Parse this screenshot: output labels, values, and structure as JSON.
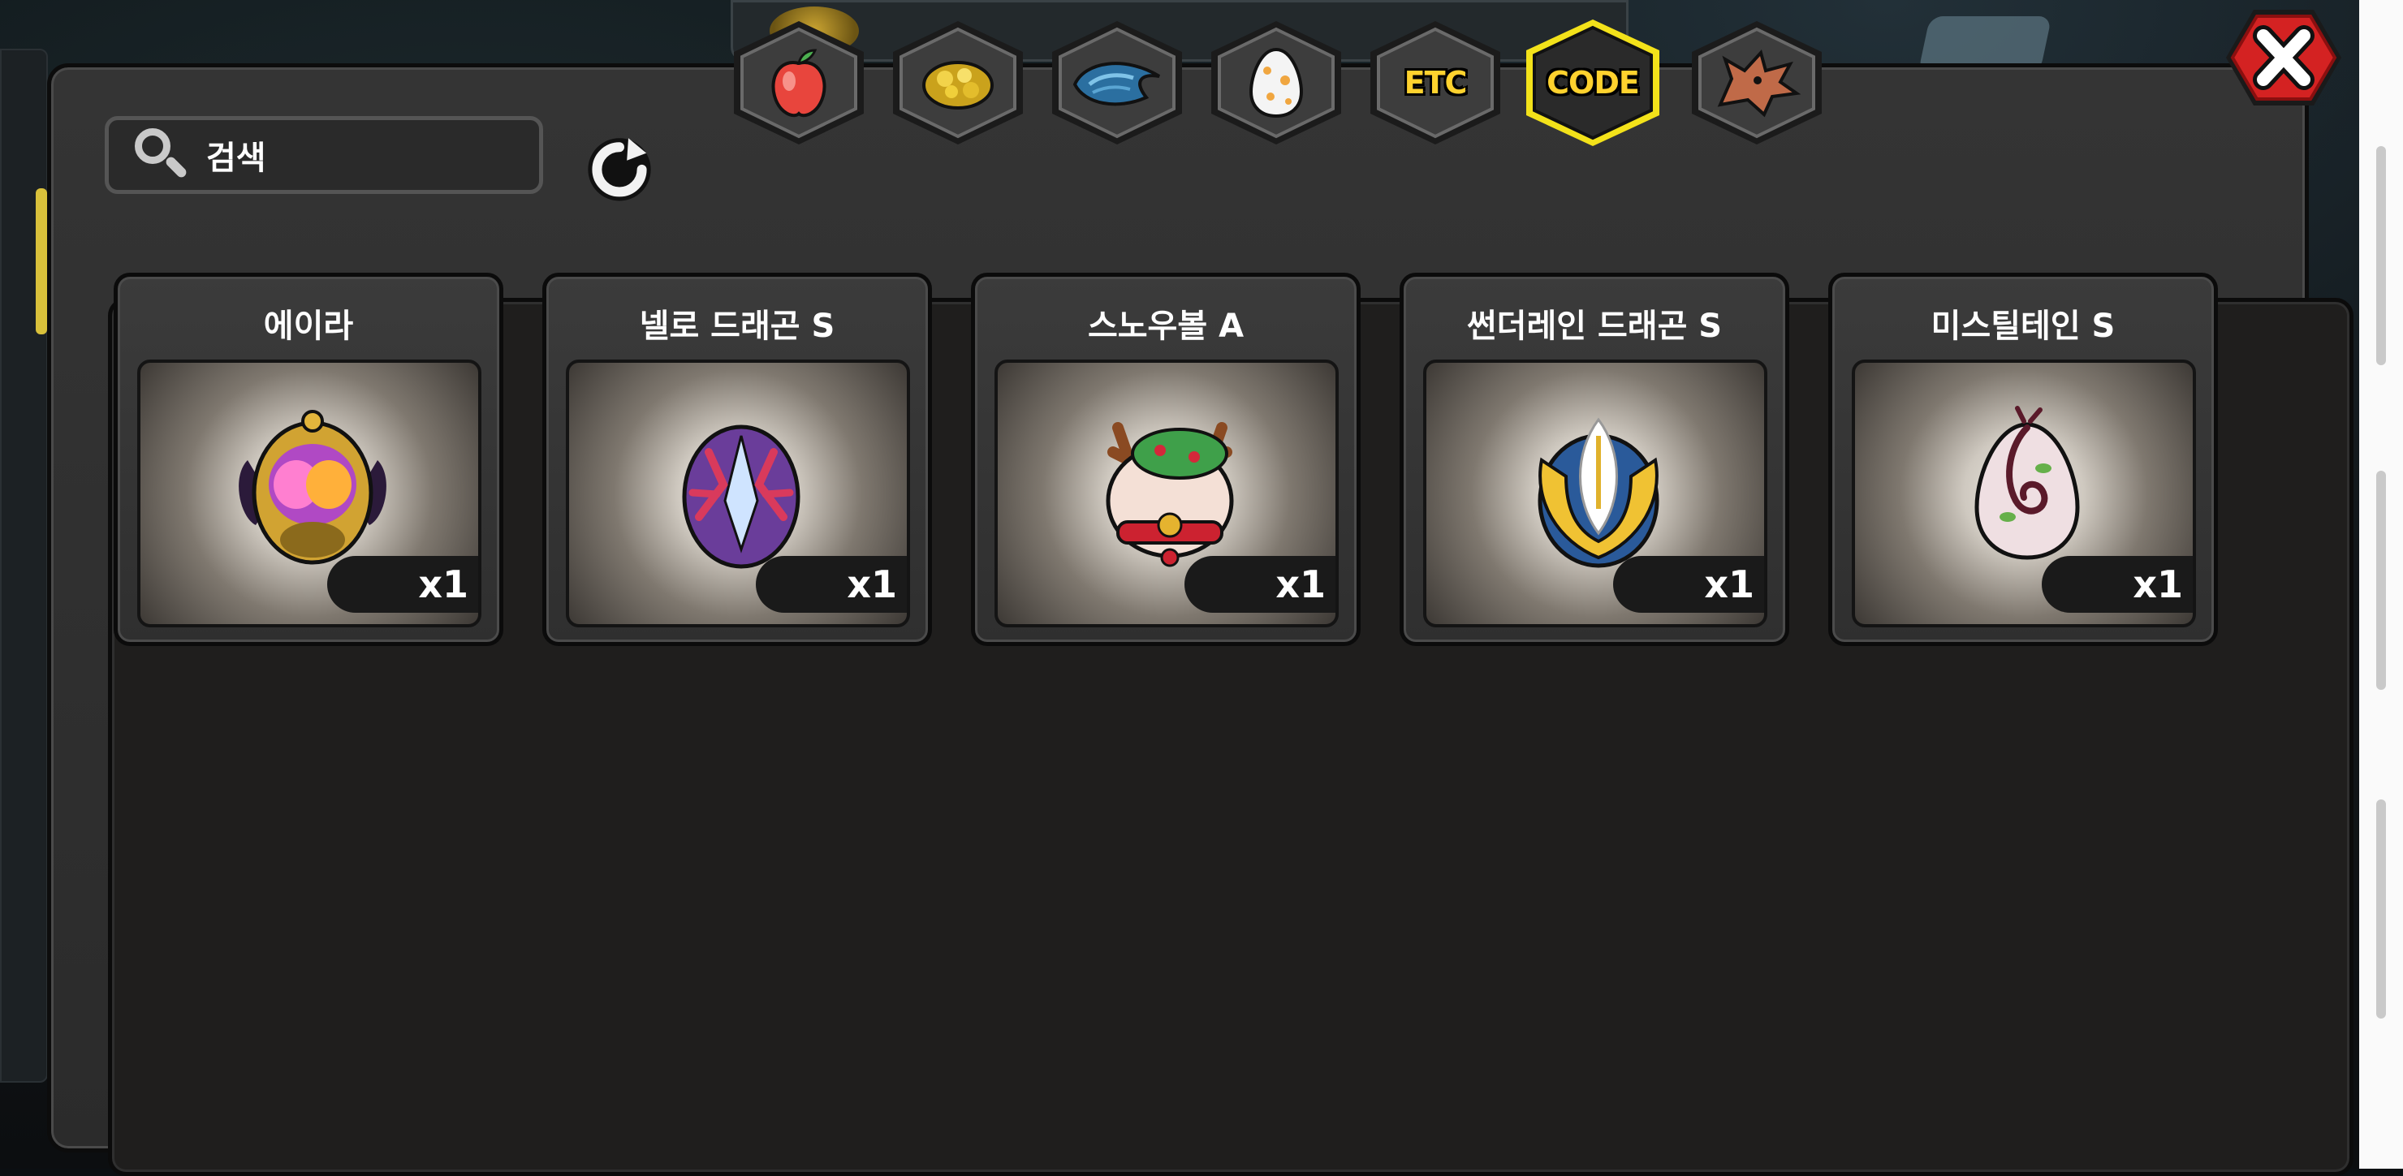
{
  "search": {
    "placeholder": "검색"
  },
  "tabs": [
    {
      "id": "fruit",
      "label": "",
      "icon": "fruit-icon",
      "selected": false
    },
    {
      "id": "gold",
      "label": "",
      "icon": "gold-icon",
      "selected": false
    },
    {
      "id": "scale",
      "label": "",
      "icon": "scale-icon",
      "selected": false
    },
    {
      "id": "egg",
      "label": "",
      "icon": "egg-icon",
      "selected": false
    },
    {
      "id": "etc",
      "label": "ETC",
      "icon": "",
      "selected": false
    },
    {
      "id": "code",
      "label": "CODE",
      "icon": "",
      "selected": true
    },
    {
      "id": "dragon",
      "label": "",
      "icon": "dragon-head-icon",
      "selected": false
    }
  ],
  "items": [
    {
      "name": "에이라",
      "qty": "x1",
      "icon": "golden-jewel-egg-icon"
    },
    {
      "name": "넬로 드래곤 S",
      "qty": "x1",
      "icon": "coral-egg-icon"
    },
    {
      "name": "스노우볼 A",
      "qty": "x1",
      "icon": "snowball-reindeer-icon"
    },
    {
      "name": "썬더레인 드래곤 S",
      "qty": "x1",
      "icon": "winged-gold-egg-icon"
    },
    {
      "name": "미스틸테인 S",
      "qty": "x1",
      "icon": "vine-egg-icon"
    }
  ],
  "colors": {
    "selected_tab_border": "#f3e21a",
    "tab_label": "#ffd22e",
    "close_button": "#d42222"
  }
}
